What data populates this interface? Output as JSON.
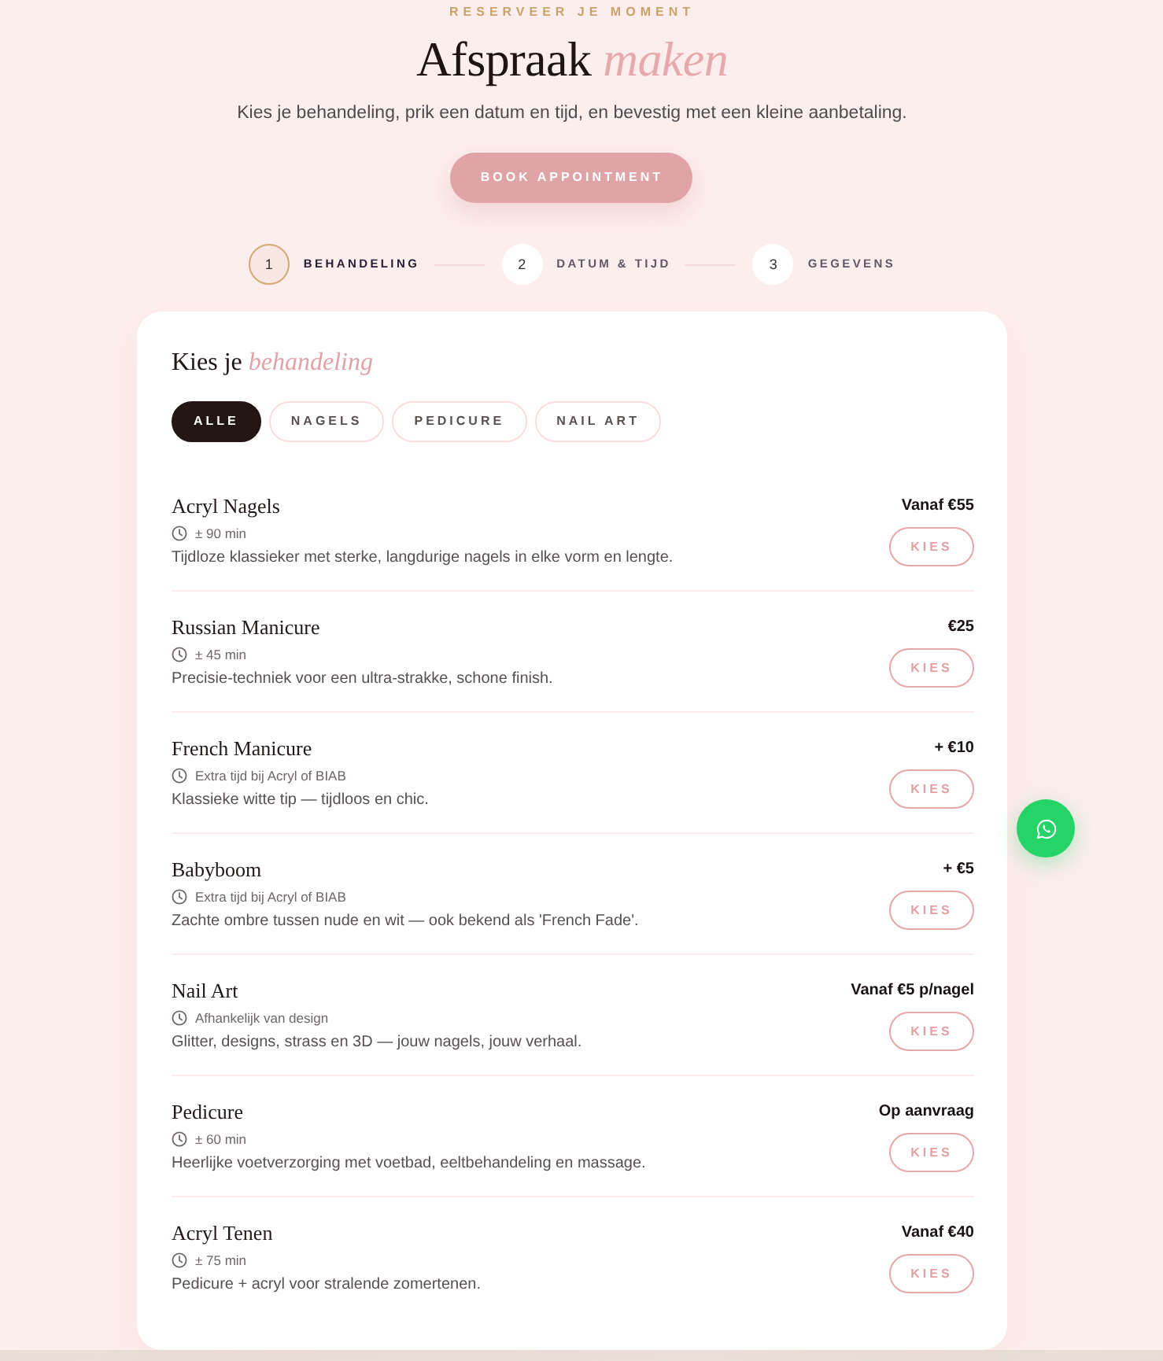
{
  "header": {
    "eyebrow": "RESERVEER JE MOMENT",
    "title": "Afspraak *maken*",
    "subtitle": "Kies je behandeling, prik een datum en tijd, en bevestig met een kleine aanbetaling.",
    "button": "BOOK APPOINTMENT"
  },
  "steps": [
    {
      "number": "1",
      "label": "BEHANDELING",
      "selected": true
    },
    {
      "number": "2",
      "label": "DATUM & TIJD",
      "selected": false
    },
    {
      "number": "3",
      "label": "GEGEVENS",
      "selected": false
    }
  ],
  "treatments": {
    "heading": "Kies je *behandeling*",
    "filters": [
      {
        "label": "ALLE",
        "selected": true
      },
      {
        "label": "NAGELS",
        "selected": false
      },
      {
        "label": "PEDICURE",
        "selected": false
      },
      {
        "label": "NAIL ART",
        "selected": false
      }
    ],
    "services": [
      {
        "name": "Acryl Nagels",
        "duration": "± 90 min",
        "description": "Tijdloze klassieker met sterke, langdurige nagels in elke vorm en lengte.",
        "price": "Vanaf €55",
        "button": "KIES"
      },
      {
        "name": "Russian Manicure",
        "duration": "± 45 min",
        "description": "Precisie-techniek voor een ultra-strakke, schone finish.",
        "price": "€25",
        "button": "KIES"
      },
      {
        "name": "French Manicure",
        "duration": "Extra tijd bij Acryl of BIAB",
        "description": "Klassieke witte tip — tijdloos en chic.",
        "price": "+ €10",
        "button": "KIES"
      },
      {
        "name": "Babyboom",
        "duration": "Extra tijd bij Acryl of BIAB",
        "description": "Zachte ombre tussen nude en wit — ook bekend als 'French Fade'.",
        "price": "+ €5",
        "button": "KIES"
      },
      {
        "name": "Nail Art",
        "duration": "Afhankelijk van design",
        "description": "Glitter, designs, strass en 3D — jouw nagels, jouw verhaal.",
        "price": "Vanaf €5 p/nagel",
        "button": "KIES"
      },
      {
        "name": "Pedicure",
        "duration": "± 60 min",
        "description": "Heerlijke voetverzorging met voetbad, eeltbehandeling en massage.",
        "price": "Op aanvraag",
        "button": "KIES"
      },
      {
        "name": "Acryl Tenen",
        "duration": "± 75 min",
        "description": "Pedicure + acryl voor stralende zomertenen.",
        "price": "Vanaf €40",
        "button": "KIES"
      }
    ]
  }
}
